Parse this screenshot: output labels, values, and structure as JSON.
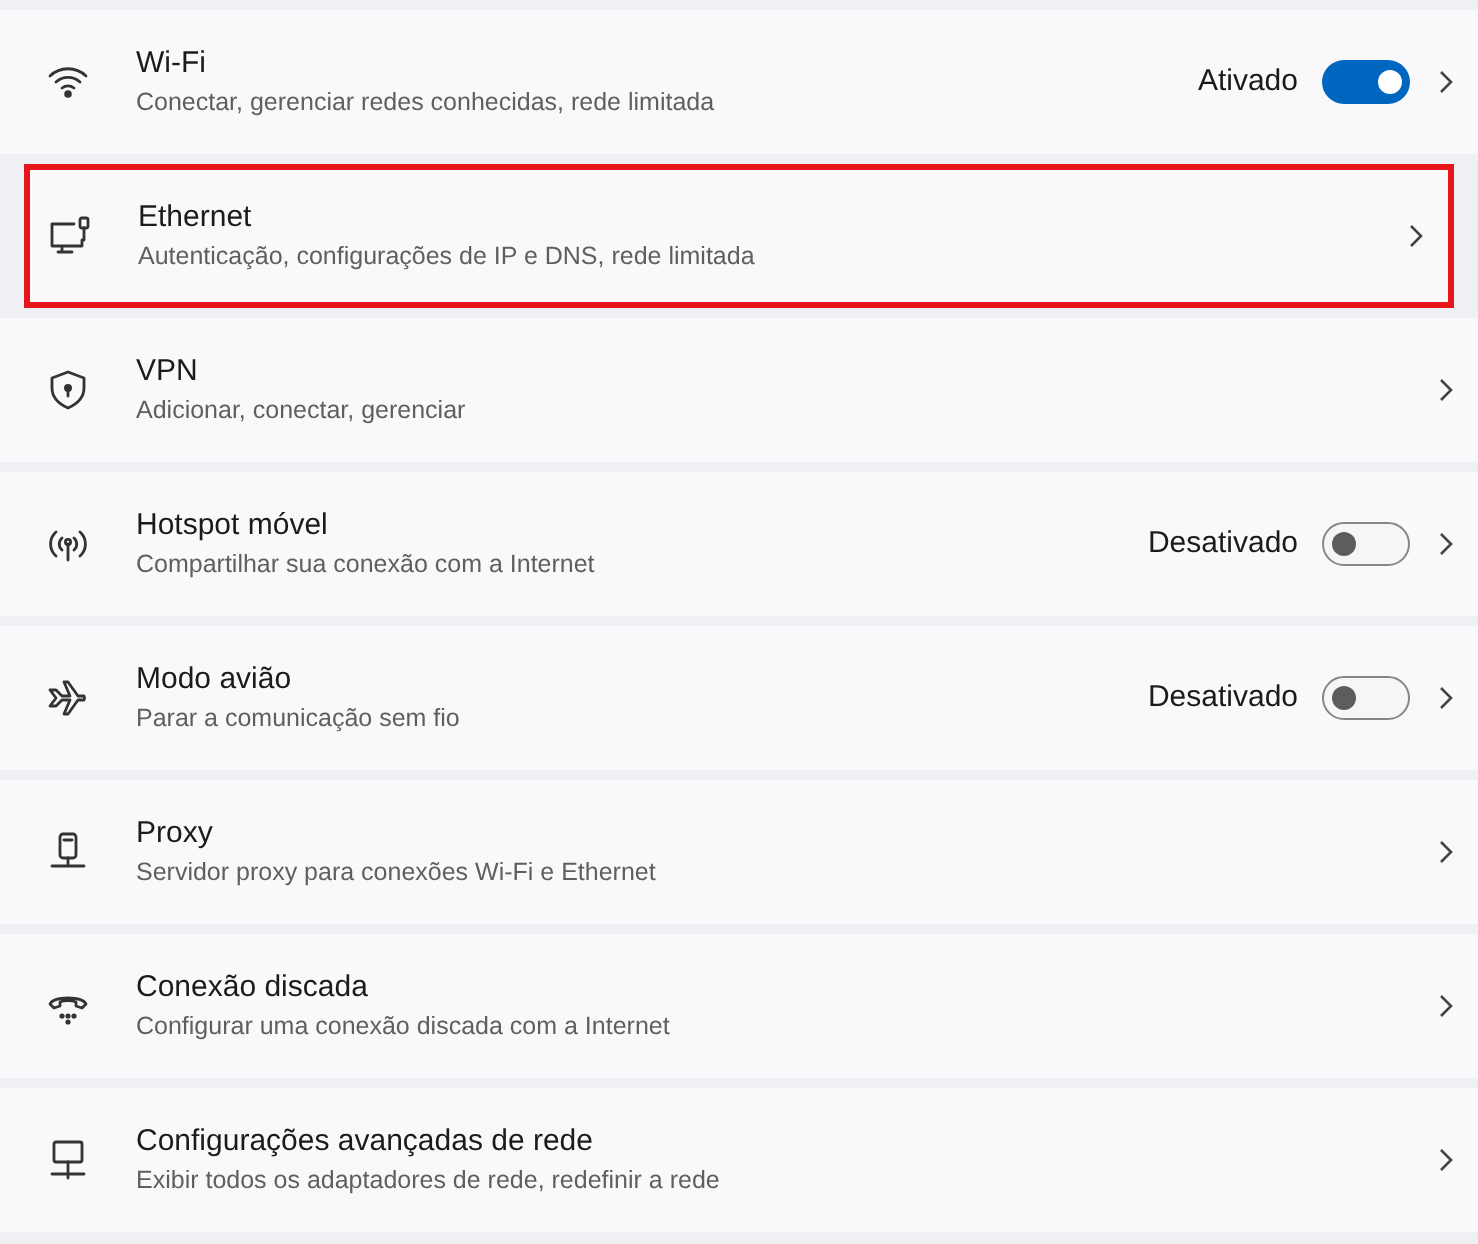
{
  "settings": [
    {
      "kind": "wifi",
      "title": "Wi-Fi",
      "subtitle": "Conectar, gerenciar redes conhecidas, rede limitada",
      "highlighted": false,
      "toggle": {
        "status": "Ativado",
        "on": true
      }
    },
    {
      "kind": "ethernet",
      "title": "Ethernet",
      "subtitle": "Autenticação, configurações de IP e DNS, rede limitada",
      "highlighted": true
    },
    {
      "kind": "vpn",
      "title": "VPN",
      "subtitle": "Adicionar, conectar, gerenciar",
      "highlighted": false
    },
    {
      "kind": "hotspot",
      "title": "Hotspot móvel",
      "subtitle": "Compartilhar sua conexão com a Internet",
      "highlighted": false,
      "toggle": {
        "status": "Desativado",
        "on": false
      }
    },
    {
      "kind": "airplane",
      "title": "Modo avião",
      "subtitle": "Parar a comunicação sem fio",
      "highlighted": false,
      "toggle": {
        "status": "Desativado",
        "on": false
      }
    },
    {
      "kind": "proxy",
      "title": "Proxy",
      "subtitle": "Servidor proxy para conexões Wi-Fi e Ethernet",
      "highlighted": false
    },
    {
      "kind": "dialup",
      "title": "Conexão discada",
      "subtitle": "Configurar uma conexão discada com a Internet",
      "highlighted": false
    },
    {
      "kind": "advanced",
      "title": "Configurações avançadas de rede",
      "subtitle": "Exibir todos os adaptadores de rede, redefinir a rede",
      "highlighted": false
    }
  ]
}
